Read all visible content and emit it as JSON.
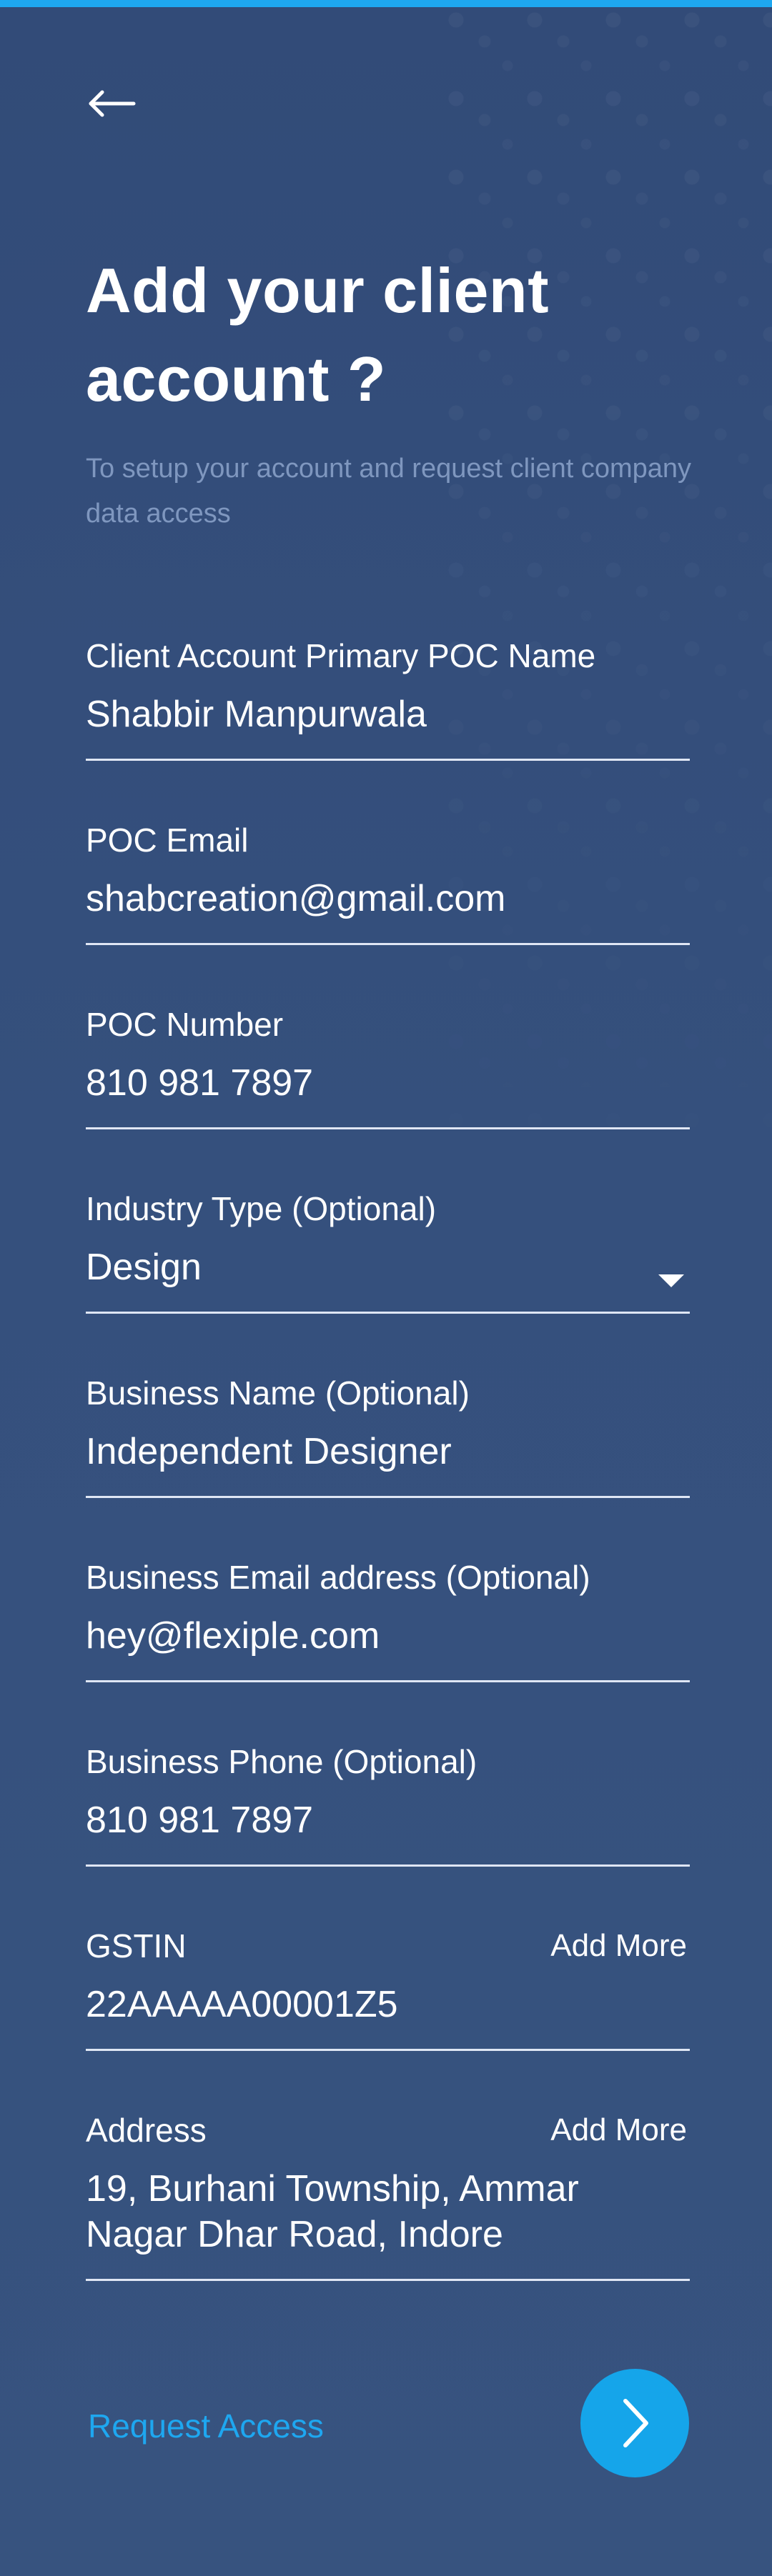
{
  "header": {
    "title": "Add your client account ?",
    "subtitle": "To setup your account and request client company data access"
  },
  "fields": [
    {
      "label": "Client Account Primary POC Name",
      "value": "Shabbir Manpurwala"
    },
    {
      "label": "POC Email",
      "value": "shabcreation@gmail.com"
    },
    {
      "label": "POC Number",
      "value": "810 981 7897"
    },
    {
      "label": "Industry Type (Optional)",
      "value": "Design"
    },
    {
      "label": "Business Name (Optional)",
      "value": "Independent Designer"
    },
    {
      "label": "Business Email address (Optional)",
      "value": "hey@flexiple.com"
    },
    {
      "label": "Business Phone (Optional)",
      "value": "810 981 7897"
    },
    {
      "label": "GSTIN",
      "value": "22AAAAA00001Z5",
      "action": "Add More"
    },
    {
      "label": "Address",
      "value": "19, Burhani Township, Ammar Nagar Dhar Road, Indore",
      "action": "Add More"
    }
  ],
  "footer": {
    "request_access": "Request Access"
  },
  "icons": {
    "back": "arrow-left-icon",
    "dropdown": "chevron-down-icon",
    "next": "arrow-right-icon"
  },
  "colors": {
    "background": "#35507d",
    "accent": "#1ea7f0",
    "text": "#ffffff",
    "subtitle": "#7f97bf",
    "divider": "#dfe6f4"
  }
}
